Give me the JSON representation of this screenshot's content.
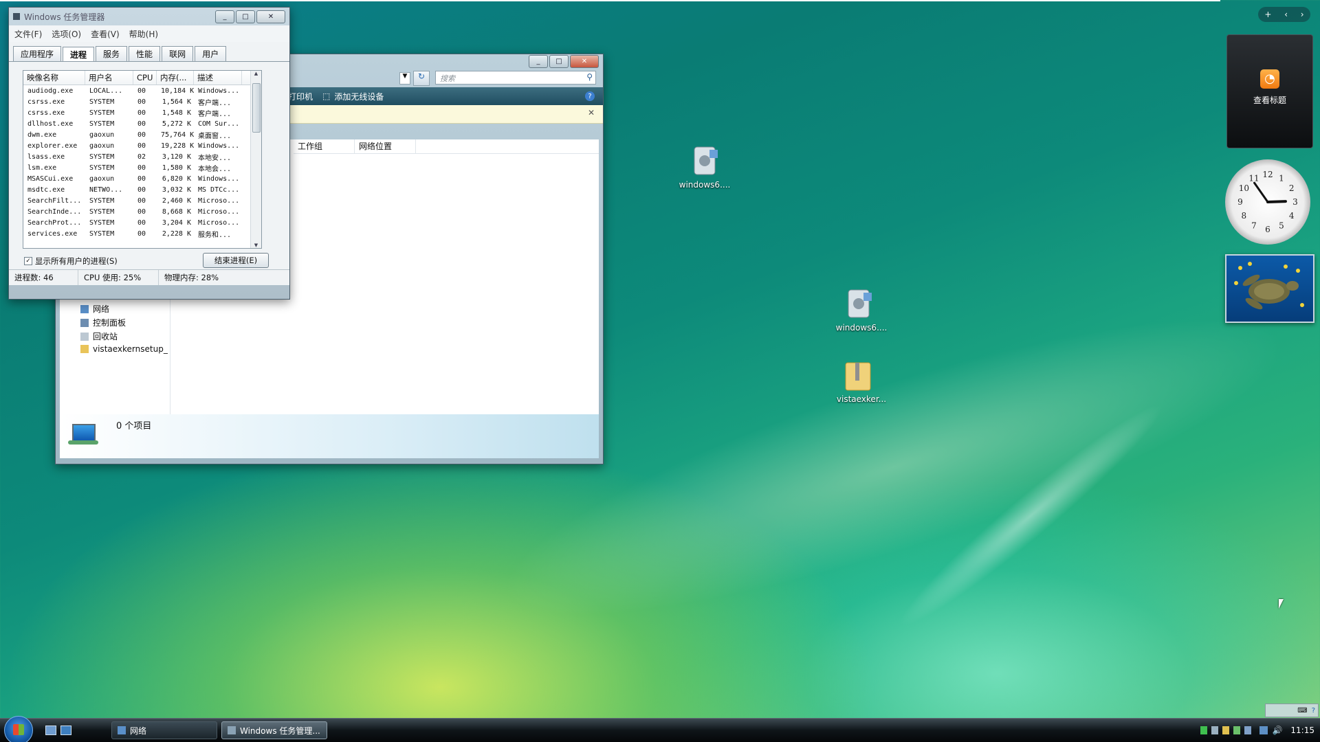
{
  "task_manager": {
    "title": "Windows 任务管理器",
    "menu": [
      "文件(F)",
      "选项(O)",
      "查看(V)",
      "帮助(H)"
    ],
    "tabs": [
      "应用程序",
      "进程",
      "服务",
      "性能",
      "联网",
      "用户"
    ],
    "active_tab": "进程",
    "columns": [
      "映像名称",
      "用户名",
      "CPU",
      "内存(...",
      "描述"
    ],
    "processes": [
      [
        "audiodg.exe",
        "LOCAL...",
        "00",
        "10,184 K",
        "Windows..."
      ],
      [
        "csrss.exe",
        "SYSTEM",
        "00",
        "1,564 K",
        "客户端..."
      ],
      [
        "csrss.exe",
        "SYSTEM",
        "00",
        "1,548 K",
        "客户端..."
      ],
      [
        "dllhost.exe",
        "SYSTEM",
        "00",
        "5,272 K",
        "COM Sur..."
      ],
      [
        "dwm.exe",
        "gaoxun",
        "00",
        "75,764 K",
        "桌面窗..."
      ],
      [
        "explorer.exe",
        "gaoxun",
        "00",
        "19,228 K",
        "Windows..."
      ],
      [
        "lsass.exe",
        "SYSTEM",
        "02",
        "3,120 K",
        "本地安..."
      ],
      [
        "lsm.exe",
        "SYSTEM",
        "00",
        "1,580 K",
        "本地会..."
      ],
      [
        "MSASCui.exe",
        "gaoxun",
        "00",
        "6,820 K",
        "Windows..."
      ],
      [
        "msdtc.exe",
        "NETWO...",
        "00",
        "3,032 K",
        "MS DTCc..."
      ],
      [
        "SearchFilt...",
        "SYSTEM",
        "00",
        "2,460 K",
        "Microso..."
      ],
      [
        "SearchInde...",
        "SYSTEM",
        "00",
        "8,668 K",
        "Microso..."
      ],
      [
        "SearchProt...",
        "SYSTEM",
        "00",
        "3,204 K",
        "Microso..."
      ],
      [
        "services.exe",
        "SYSTEM",
        "00",
        "2,228 K",
        "服务和..."
      ]
    ],
    "show_all_label": "显示所有用户的进程(S)",
    "end_process_label": "结束进程(E)",
    "status_processes": "进程数: 46",
    "status_cpu": "CPU 使用: 25%",
    "status_memory": "物理内存: 28%"
  },
  "explorer": {
    "search_placeholder": "搜索",
    "toolbar_printer": "打印机",
    "toolbar_wireless": "添加无线设备",
    "col_workgroup": "工作组",
    "col_location": "网络位置",
    "nav_items": [
      "网络",
      "控制面板",
      "回收站",
      "vistaexkernsetup_"
    ],
    "status_count": "0 个项目"
  },
  "desktop_icons": [
    "windows6....",
    "windows6....",
    "vistaexker..."
  ],
  "sidebar": {
    "rss_label": "查看标题",
    "clock_numbers": [
      "12",
      "1",
      "2",
      "3",
      "4",
      "5",
      "6",
      "7",
      "8",
      "9",
      "10",
      "11"
    ]
  },
  "taskbar": {
    "tasks": [
      "网络",
      "Windows 任务管理..."
    ],
    "clock": "11:15"
  }
}
